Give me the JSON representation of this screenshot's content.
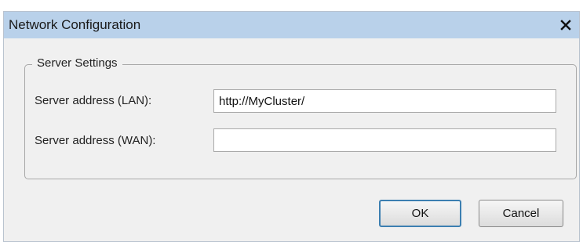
{
  "window": {
    "title": "Network Configuration",
    "close_glyph": "✕"
  },
  "group": {
    "label": "Server Settings"
  },
  "fields": {
    "lan": {
      "label": "Server address (LAN):",
      "value": "http://MyCluster/"
    },
    "wan": {
      "label": "Server address (WAN):",
      "value": ""
    }
  },
  "buttons": {
    "ok_label": "OK",
    "cancel_label": "Cancel"
  },
  "colors": {
    "titlebar": "#b9d1ea",
    "dialog_bg": "#f0f0f0",
    "default_button_border": "#3c7fb1"
  }
}
